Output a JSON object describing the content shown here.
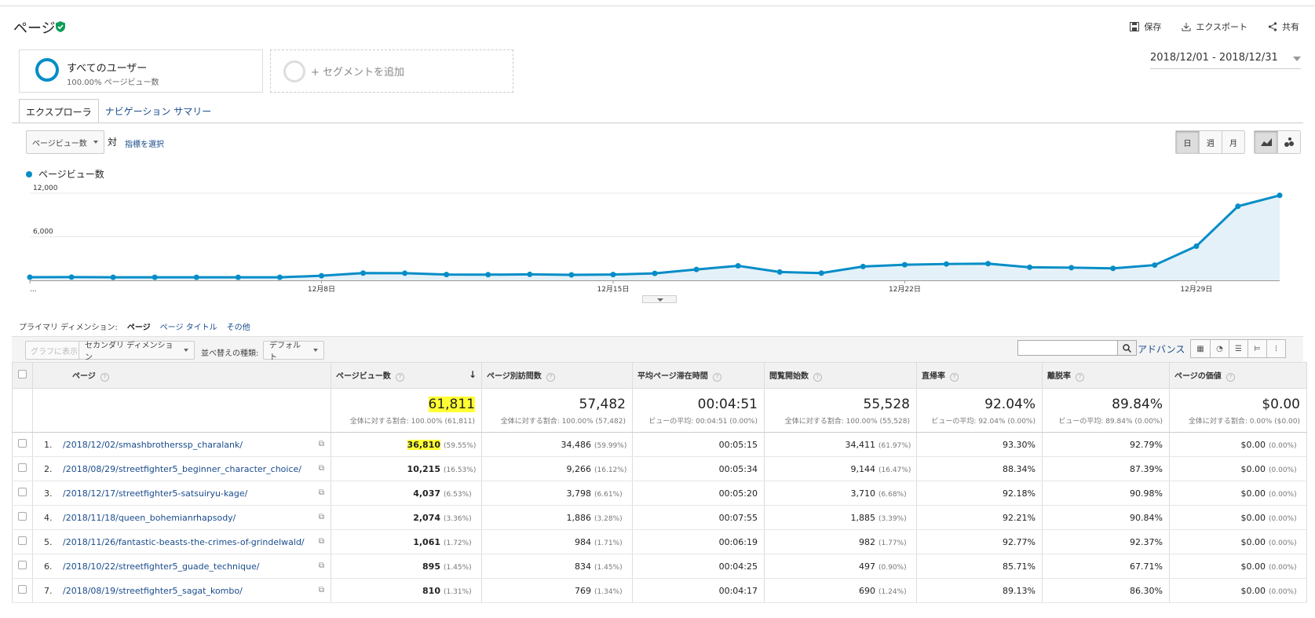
{
  "header": {
    "title": "ページ",
    "actions": {
      "save": "保存",
      "export": "エクスポート",
      "share": "共有"
    }
  },
  "segments": {
    "primary_name": "すべてのユーザー",
    "primary_sub": "100.00% ページビュー数",
    "add_label": "+ セグメントを追加"
  },
  "date_range": "2018/12/01 - 2018/12/31",
  "tabs": [
    "エクスプローラ",
    "ナビゲーション サマリー"
  ],
  "controls": {
    "metric_select": "ページビュー数",
    "vs": "対",
    "metric_link": "指標を選択",
    "granularity": [
      "日",
      "週",
      "月"
    ]
  },
  "chart_data": {
    "type": "area",
    "legend": "ページビュー数",
    "series_color": "#058dc7",
    "y_ticks": [
      "12,000",
      "6,000"
    ],
    "x_tick_labels": [
      "...",
      "12月8日",
      "12月15日",
      "12月22日",
      "12月29日"
    ],
    "x": [
      "12/1",
      "12/2",
      "12/3",
      "12/4",
      "12/5",
      "12/6",
      "12/7",
      "12/8",
      "12/9",
      "12/10",
      "12/11",
      "12/12",
      "12/13",
      "12/14",
      "12/15",
      "12/16",
      "12/17",
      "12/18",
      "12/19",
      "12/20",
      "12/21",
      "12/22",
      "12/23",
      "12/24",
      "12/25",
      "12/26",
      "12/27",
      "12/28",
      "12/29",
      "12/30",
      "12/31"
    ],
    "values": [
      430,
      440,
      420,
      420,
      420,
      420,
      420,
      630,
      1000,
      980,
      800,
      780,
      820,
      760,
      800,
      960,
      1500,
      2000,
      1150,
      1000,
      1900,
      2150,
      2250,
      2300,
      1800,
      1750,
      1650,
      2100,
      4700,
      10200,
      11700
    ],
    "ylim": [
      0,
      12000
    ]
  },
  "table_controls": {
    "primary_dim_label": "プライマリ ディメンション:",
    "primary_dim_current": "ページ",
    "primary_dim_alt": "ページ タイトル",
    "primary_dim_other": "その他",
    "show_graph": "グラフに表示",
    "secondary_dim": "セカンダリ ディメンション",
    "sort_label": "並べ替えの種類:",
    "sort_value": "デフォルト",
    "advanced": "アドバンス"
  },
  "table": {
    "headers": [
      "ページ",
      "ページビュー数",
      "ページ別訪問数",
      "平均ページ滞在時間",
      "閲覧開始数",
      "直帰率",
      "離脱率",
      "ページの価値"
    ],
    "totals": [
      {
        "value": "61,811",
        "sub": "全体に対する割合: 100.00% (61,811)"
      },
      {
        "value": "57,482",
        "sub": "全体に対する割合: 100.00% (57,482)"
      },
      {
        "value": "00:04:51",
        "sub": "ビューの平均: 00:04:51 (0.00%)"
      },
      {
        "value": "55,528",
        "sub": "全体に対する割合: 100.00% (55,528)"
      },
      {
        "value": "92.04%",
        "sub": "ビューの平均: 92.04% (0.00%)"
      },
      {
        "value": "89.84%",
        "sub": "ビューの平均: 89.84% (0.00%)"
      },
      {
        "value": "$0.00",
        "sub": "全体に対する割合: 0.00% ($0.00)"
      }
    ],
    "rows": [
      {
        "n": "1.",
        "page": "/2018/12/02/smashbrotherssp_charalank/",
        "pv": "36,810",
        "pv_p": "(59.55%)",
        "uv": "34,486",
        "uv_p": "(59.99%)",
        "avg": "00:05:15",
        "ent": "34,411",
        "ent_p": "(61.97%)",
        "bounce": "93.30%",
        "exit": "92.79%",
        "val": "$0.00",
        "val_p": "(0.00%)"
      },
      {
        "n": "2.",
        "page": "/2018/08/29/streetfighter5_beginner_character_choice/",
        "pv": "10,215",
        "pv_p": "(16.53%)",
        "uv": "9,266",
        "uv_p": "(16.12%)",
        "avg": "00:05:34",
        "ent": "9,144",
        "ent_p": "(16.47%)",
        "bounce": "88.34%",
        "exit": "87.39%",
        "val": "$0.00",
        "val_p": "(0.00%)"
      },
      {
        "n": "3.",
        "page": "/2018/12/17/streetfighter5-satsuiryu-kage/",
        "pv": "4,037",
        "pv_p": "(6.53%)",
        "uv": "3,798",
        "uv_p": "(6.61%)",
        "avg": "00:05:20",
        "ent": "3,710",
        "ent_p": "(6.68%)",
        "bounce": "92.18%",
        "exit": "90.98%",
        "val": "$0.00",
        "val_p": "(0.00%)"
      },
      {
        "n": "4.",
        "page": "/2018/11/18/queen_bohemianrhapsody/",
        "pv": "2,074",
        "pv_p": "(3.36%)",
        "uv": "1,886",
        "uv_p": "(3.28%)",
        "avg": "00:07:55",
        "ent": "1,885",
        "ent_p": "(3.39%)",
        "bounce": "92.21%",
        "exit": "90.84%",
        "val": "$0.00",
        "val_p": "(0.00%)"
      },
      {
        "n": "5.",
        "page": "/2018/11/26/fantastic-beasts-the-crimes-of-grindelwald/",
        "pv": "1,061",
        "pv_p": "(1.72%)",
        "uv": "984",
        "uv_p": "(1.71%)",
        "avg": "00:06:19",
        "ent": "982",
        "ent_p": "(1.77%)",
        "bounce": "92.77%",
        "exit": "92.37%",
        "val": "$0.00",
        "val_p": "(0.00%)"
      },
      {
        "n": "6.",
        "page": "/2018/10/22/streetfighter5_guade_technique/",
        "pv": "895",
        "pv_p": "(1.45%)",
        "uv": "834",
        "uv_p": "(1.45%)",
        "avg": "00:04:25",
        "ent": "497",
        "ent_p": "(0.90%)",
        "bounce": "85.71%",
        "exit": "67.71%",
        "val": "$0.00",
        "val_p": "(0.00%)"
      },
      {
        "n": "7.",
        "page": "/2018/08/19/streetfighter5_sagat_kombo/",
        "pv": "810",
        "pv_p": "(1.31%)",
        "uv": "769",
        "uv_p": "(1.34%)",
        "avg": "00:04:17",
        "ent": "690",
        "ent_p": "(1.24%)",
        "bounce": "89.13%",
        "exit": "86.30%",
        "val": "$0.00",
        "val_p": "(0.00%)"
      }
    ]
  }
}
